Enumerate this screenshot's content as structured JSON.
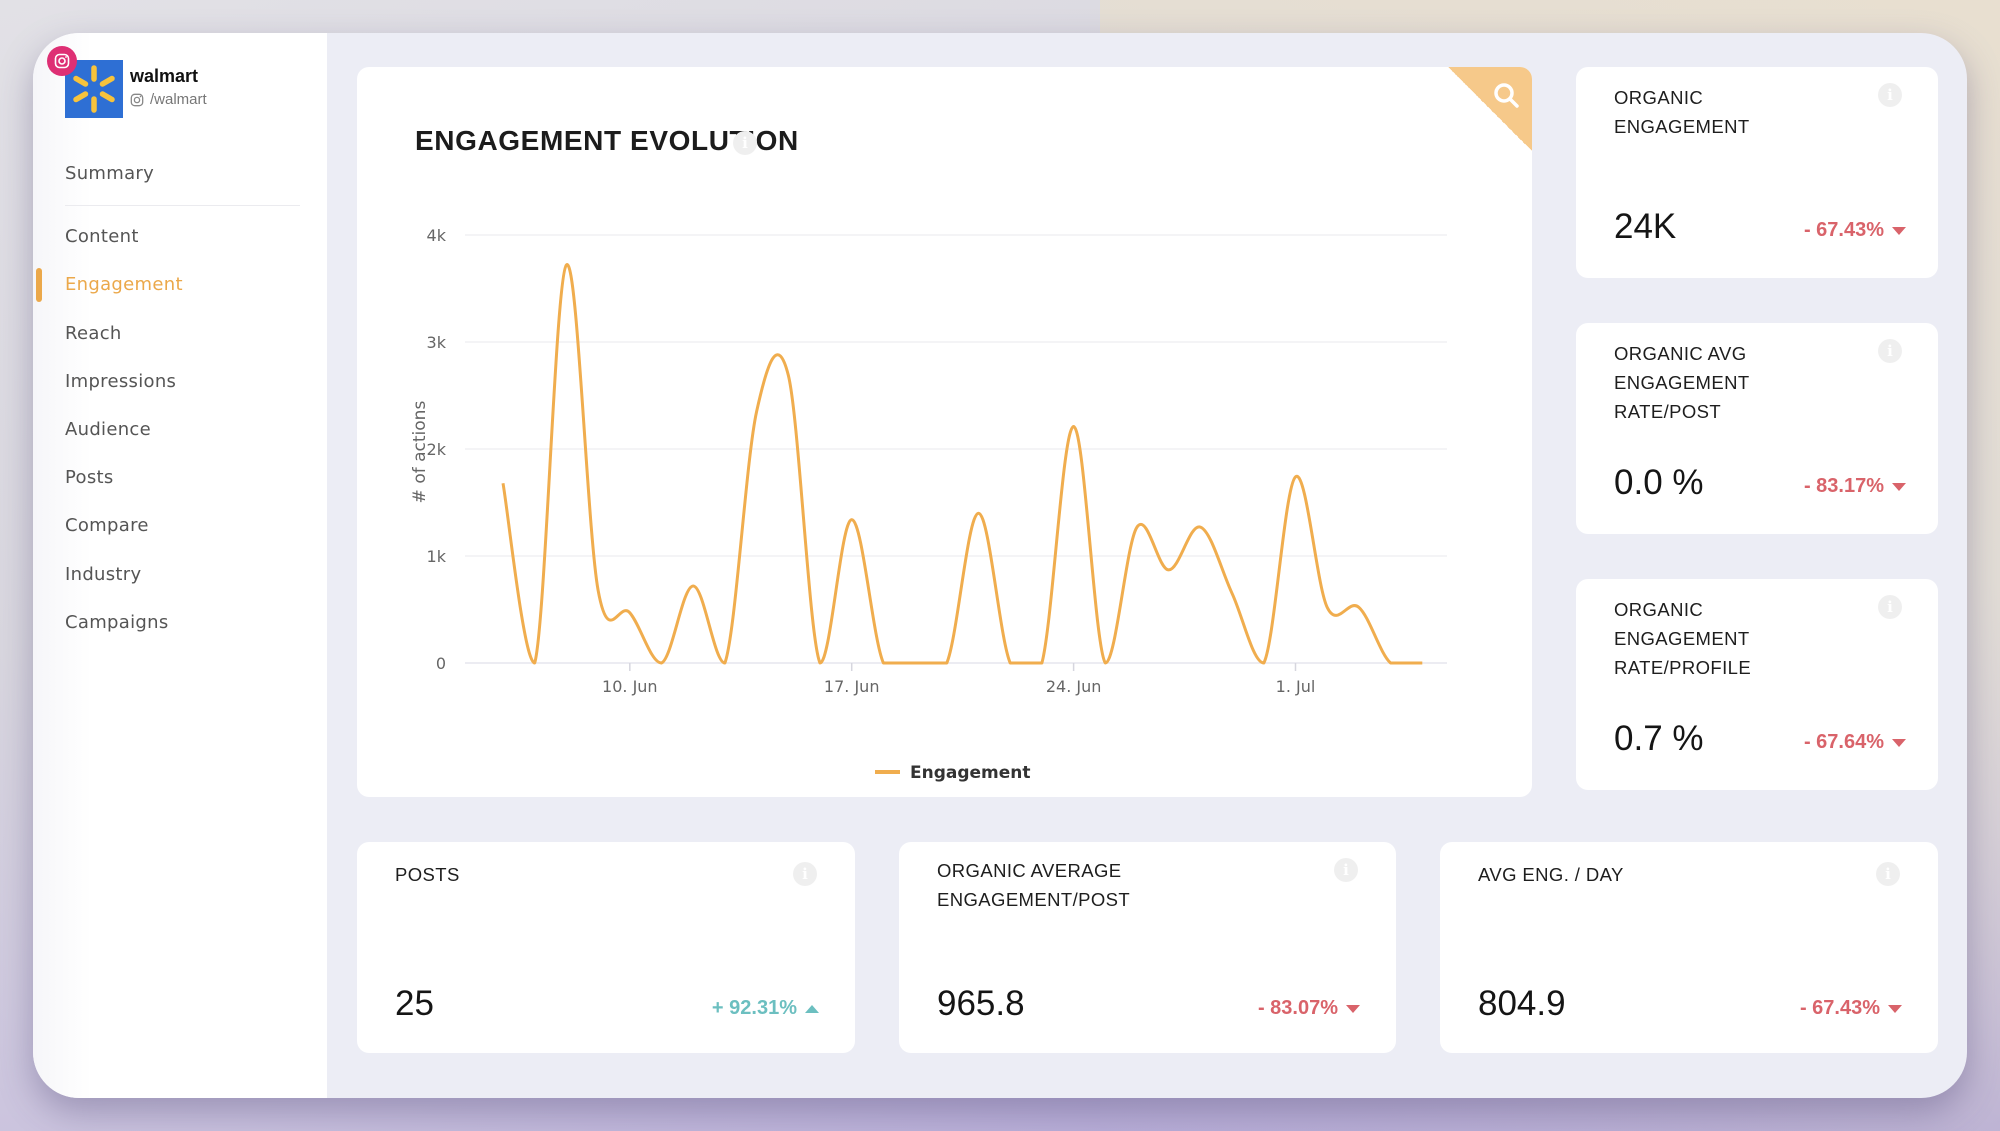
{
  "profile": {
    "name": "walmart",
    "handle": "/walmart",
    "network": "instagram"
  },
  "sidebar": {
    "items": [
      {
        "label": "Summary",
        "active": false
      },
      {
        "label": "Content",
        "active": false
      },
      {
        "label": "Engagement",
        "active": true
      },
      {
        "label": "Reach",
        "active": false
      },
      {
        "label": "Impressions",
        "active": false
      },
      {
        "label": "Audience",
        "active": false
      },
      {
        "label": "Posts",
        "active": false
      },
      {
        "label": "Compare",
        "active": false
      },
      {
        "label": "Industry",
        "active": false
      },
      {
        "label": "Campaigns",
        "active": false
      }
    ]
  },
  "colors": {
    "accent": "#eba84a",
    "series": "#f0ad4e",
    "negative": "#d9636a",
    "positive": "#6cbfc0",
    "search_corner": "#f6c98a",
    "instagram_badge": "#de2f74",
    "walmart_blue": "#2e6fd4",
    "walmart_yellow": "#f7c33c"
  },
  "chart_card": {
    "title": "ENGAGEMENT EVOLUTION",
    "info_icon": "info-icon",
    "corner_icon": "search-icon"
  },
  "chart_data": {
    "type": "line",
    "title": "ENGAGEMENT EVOLUTION",
    "xlabel": "",
    "ylabel": "# of actions",
    "ylim": [
      0,
      4000
    ],
    "yticks": [
      0,
      1000,
      2000,
      3000,
      4000
    ],
    "ytick_labels": [
      "0",
      "1k",
      "2k",
      "3k",
      "4k"
    ],
    "xtick_labels": [
      "10. Jun",
      "17. Jun",
      "24. Jun",
      "1. Jul"
    ],
    "xtick_dates": [
      "10 Jun",
      "17 Jun",
      "24 Jun",
      "1 Jul"
    ],
    "grid": true,
    "legend": {
      "position": "bottom-center",
      "entries": [
        "Engagement"
      ]
    },
    "x": [
      "6 Jun",
      "7 Jun",
      "8 Jun",
      "9 Jun",
      "10 Jun",
      "11 Jun",
      "12 Jun",
      "13 Jun",
      "14 Jun",
      "15 Jun",
      "16 Jun",
      "17 Jun",
      "18 Jun",
      "19 Jun",
      "20 Jun",
      "21 Jun",
      "22 Jun",
      "23 Jun",
      "24 Jun",
      "25 Jun",
      "26 Jun",
      "27 Jun",
      "28 Jun",
      "29 Jun",
      "30 Jun",
      "1 Jul",
      "2 Jul",
      "3 Jul",
      "4 Jul",
      "5 Jul"
    ],
    "series": [
      {
        "name": "Engagement",
        "values": [
          1680,
          0,
          3720,
          680,
          470,
          0,
          720,
          0,
          2350,
          2690,
          0,
          1340,
          0,
          0,
          0,
          1400,
          0,
          0,
          2210,
          0,
          1270,
          870,
          1270,
          650,
          0,
          1740,
          520,
          520,
          0,
          0
        ]
      }
    ]
  },
  "kpis_side": [
    {
      "title": "ORGANIC ENGAGEMENT",
      "value": "24K",
      "change": "- 67.43%",
      "direction": "down"
    },
    {
      "title": "ORGANIC AVG ENGAGEMENT RATE/POST",
      "value": "0.0 %",
      "change": "- 83.17%",
      "direction": "down"
    },
    {
      "title": "ORGANIC ENGAGEMENT RATE/PROFILE",
      "value": "0.7 %",
      "change": "- 67.64%",
      "direction": "down"
    }
  ],
  "kpis_bottom": [
    {
      "title": "POSTS",
      "value": "25",
      "change": "+ 92.31%",
      "direction": "up"
    },
    {
      "title": "ORGANIC AVERAGE ENGAGEMENT/POST",
      "value": "965.8",
      "change": "- 83.07%",
      "direction": "down"
    },
    {
      "title": "AVG ENG. / DAY",
      "value": "804.9",
      "change": "- 67.43%",
      "direction": "down"
    }
  ]
}
